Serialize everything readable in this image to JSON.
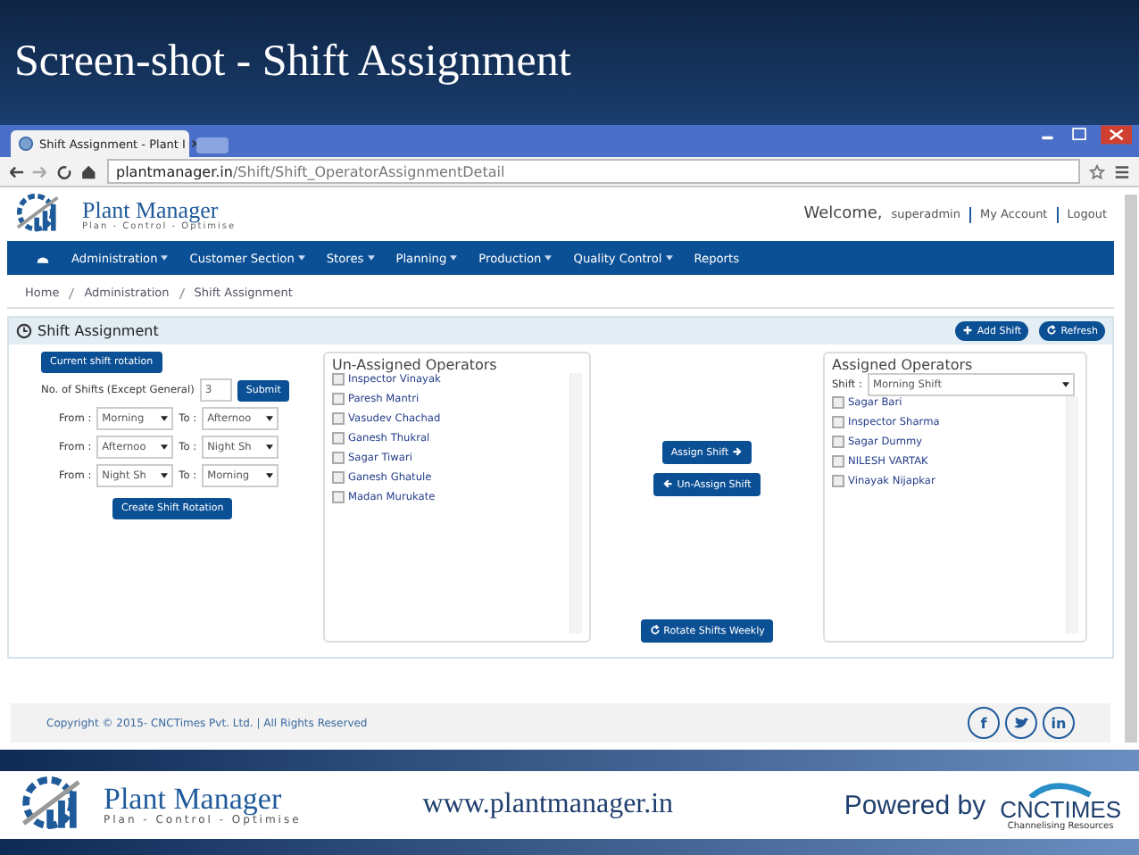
{
  "slide_title": "Screen-shot - Shift Assignment",
  "browser": {
    "tab_title": "Shift Assignment - Plant I",
    "url_host": "plantmanager.in",
    "url_path": "/Shift/Shift_OperatorAssignmentDetail"
  },
  "app_header": {
    "brand": "Plant Manager",
    "tagline": "Plan - Control - Optimise",
    "welcome": "Welcome,",
    "user": "superadmin",
    "my_account": "My Account",
    "logout": "Logout"
  },
  "nav": [
    {
      "label": "Administration",
      "dropdown": true
    },
    {
      "label": "Customer Section",
      "dropdown": true
    },
    {
      "label": "Stores",
      "dropdown": true
    },
    {
      "label": "Planning",
      "dropdown": true
    },
    {
      "label": "Production",
      "dropdown": true
    },
    {
      "label": "Quality Control",
      "dropdown": true
    },
    {
      "label": "Reports",
      "dropdown": false
    }
  ],
  "breadcrumb": [
    "Home",
    "Administration",
    "Shift Assignment"
  ],
  "panel": {
    "title": "Shift Assignment",
    "buttons": [
      {
        "label": "Add Shift",
        "kind": "plus"
      },
      {
        "label": "Refresh",
        "kind": "refresh"
      }
    ]
  },
  "rotation": {
    "current_button": "Current shift rotation",
    "shifts_label": "No. of Shifts (Except General)",
    "shifts_value": "3",
    "submit": "Submit",
    "rows": [
      {
        "from_label": "From :",
        "from": "Morning",
        "to_label": "To :",
        "to": "Afternoo"
      },
      {
        "from_label": "From :",
        "from": "Afternoo",
        "to_label": "To :",
        "to": "Night Sh"
      },
      {
        "from_label": "From :",
        "from": "Night Sh",
        "to_label": "To :",
        "to": "Morning"
      }
    ],
    "create_button": "Create Shift Rotation"
  },
  "unassigned": {
    "title": "Un-Assigned Operators",
    "items": [
      {
        "name": "Inspector Vinayak",
        "checked": false
      },
      {
        "name": "Paresh Mantri",
        "checked": false
      },
      {
        "name": "Vasudev Chachad",
        "checked": false
      },
      {
        "name": "Ganesh Thukral",
        "checked": false
      },
      {
        "name": "Sagar Tiwari",
        "checked": false
      },
      {
        "name": "Ganesh Ghatule",
        "checked": false
      },
      {
        "name": "Madan Murukate",
        "checked": false
      }
    ]
  },
  "actions": {
    "assign": "Assign Shift",
    "unassign": "Un-Assign Shift",
    "rotate": "Rotate Shifts Weekly"
  },
  "assigned": {
    "title": "Assigned Operators",
    "shift_label": "Shift :",
    "shift_value": "Morning Shift",
    "items": [
      {
        "name": "Sagar Bari",
        "checked": false
      },
      {
        "name": "Inspector Sharma",
        "checked": false
      },
      {
        "name": "Sagar Dummy",
        "checked": false
      },
      {
        "name": "NILESH VARTAK",
        "checked": false
      },
      {
        "name": "Vinayak Nijapkar",
        "checked": false
      }
    ]
  },
  "footer": {
    "copyright": "Copyright © 2015- CNCTimes Pvt. Ltd. | All Rights Reserved",
    "social": [
      {
        "kind": "text",
        "label": "f"
      },
      {
        "kind": "bird"
      },
      {
        "kind": "text",
        "label": "in"
      }
    ]
  },
  "slide_footer": {
    "brand": "Plant Manager",
    "tagline": "Plan - Control - Optimise",
    "website": "www.plantmanager.in",
    "powered": "Powered by",
    "company": "CNCTIMES",
    "company_tagline": "Channelising Resources"
  }
}
